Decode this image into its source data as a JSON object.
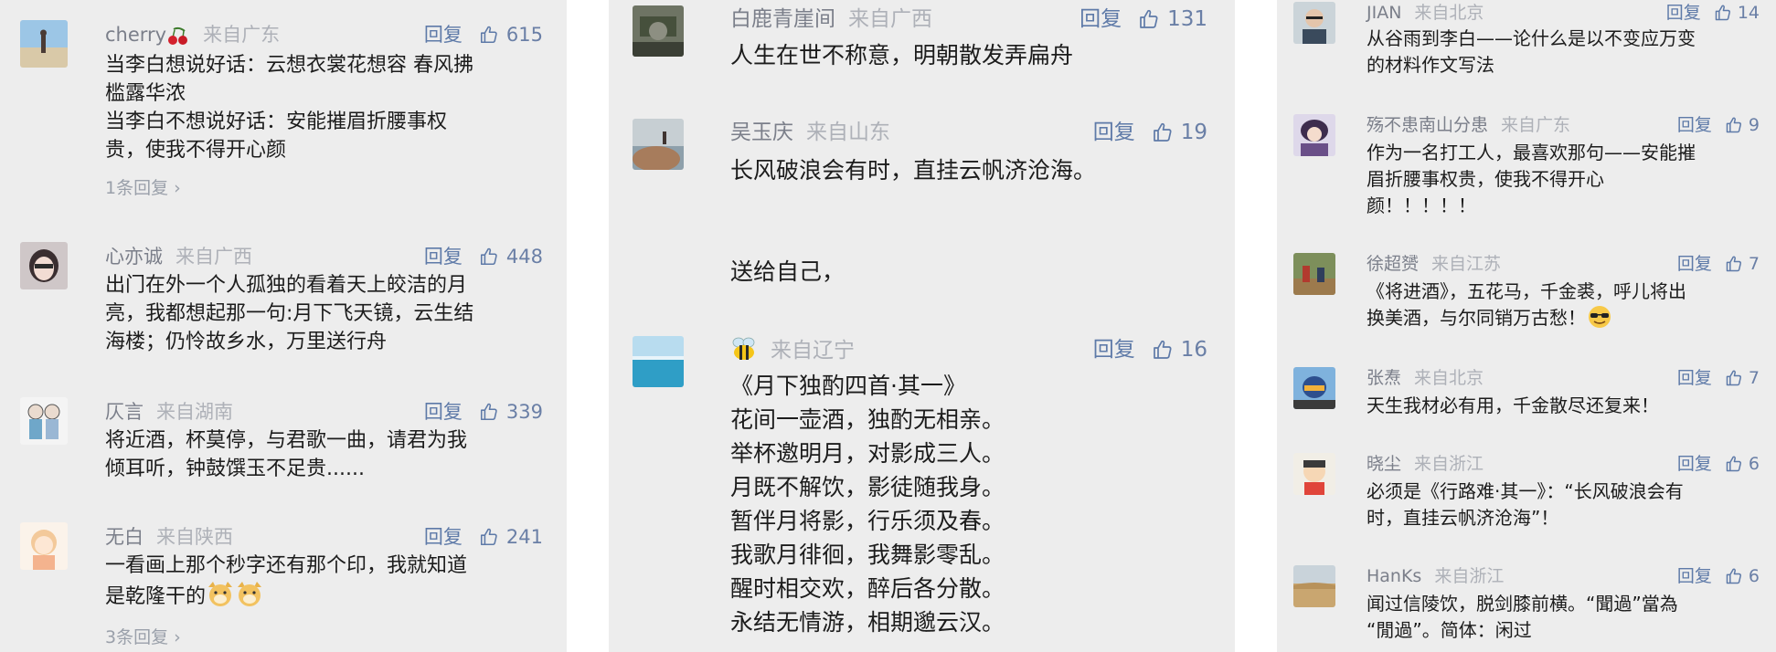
{
  "ui": {
    "reply_label": "回复",
    "like_color": "#5e7aa8",
    "like_icon": "thumbs-up-icon"
  },
  "panel_1": {
    "comments": [
      {
        "username": "cherry",
        "username_emoji": "cherry-emoji",
        "location": "来自广东",
        "likes": "615",
        "lines": [
          "当李白想说好话：云想衣裳花想容 春风拂",
          "槛露华浓",
          "当李白不想说好话：安能摧眉折腰事权",
          "贵，使我不得开心颜"
        ],
        "more_replies": "1条回复",
        "avatar": "beach-person-avatar"
      },
      {
        "username": "心亦诚",
        "location": "来自广西",
        "likes": "448",
        "lines": [
          "出门在外一个人孤独的看着天上皎洁的月",
          "亮，我都想起那一句:月下飞天镜，云生结",
          "海楼；仍怜故乡水，万里送行舟"
        ],
        "avatar": "girl-portrait-avatar"
      },
      {
        "username": "仄言",
        "location": "来自湖南",
        "likes": "339",
        "lines": [
          "将近酒，杯莫停，与君歌一曲，请君为我",
          "倾耳听，钟鼓馔玉不足贵......"
        ],
        "avatar": "cartoon-couple-avatar"
      },
      {
        "username": "无白",
        "location": "来自陕西",
        "likes": "241",
        "lines": [
          "一看画上那个秒字还有那个印，我就知道",
          "是乾隆干的"
        ],
        "line_emoji": "doge-emoji",
        "more_replies": "3条回复",
        "avatar": "cartoon-girl-avatar"
      }
    ]
  },
  "panel_2": {
    "comments": [
      {
        "username": "白鹿青崖间",
        "location": "来自广西",
        "likes": "131",
        "lines": [
          "人生在世不称意，明朝散发弄扁舟"
        ],
        "avatar": "soldier-avatar"
      },
      {
        "username": "吴玉庆",
        "location": "来自山东",
        "likes": "19",
        "lines": [
          "长风破浪会有时，直挂云帆济沧海。",
          "",
          "",
          "送给自己，"
        ],
        "avatar": "rock-sea-avatar"
      },
      {
        "username": "",
        "username_emoji": "bee-emoji",
        "location": "来自辽宁",
        "likes": "16",
        "lines": [
          "《月下独酌四首·其一》",
          "花间一壶酒，独酌无相亲。",
          "举杯邀明月，对影成三人。",
          "月既不解饮，影徒随我身。",
          "暂伴月将影，行乐须及春。",
          "我歌月徘徊，我舞影零乱。",
          "醒时相交欢，醉后各分散。",
          "永结无情游，相期邈云汉。"
        ],
        "avatar": "sea-view-avatar"
      }
    ]
  },
  "panel_3": {
    "comments": [
      {
        "username": "JIAN",
        "location": "来自北京",
        "likes": "14",
        "lines": [
          "从谷雨到李白——论什么是以不变应万变",
          "的材料作文写法"
        ],
        "avatar": "man-glasses-avatar"
      },
      {
        "username": "殇不患南山分患",
        "location": "来自广东",
        "likes": "9",
        "lines": [
          "作为一名打工人，最喜欢那句——安能摧",
          "眉折腰事权贵，使我不得开心",
          "颜！！！！！"
        ],
        "avatar": "anime-character-avatar"
      },
      {
        "username": "徐超赟",
        "location": "来自江苏",
        "likes": "7",
        "lines": [
          "《将进酒》，五花马，千金裘，呼儿将出",
          "换美酒，与尔同销万古愁！"
        ],
        "line_emoji": "cool-sunglasses-emoji",
        "avatar": "outdoor-group-avatar"
      },
      {
        "username": "张焘",
        "location": "来自北京",
        "likes": "7",
        "lines": [
          "天生我材必有用，千金散尽还复来！"
        ],
        "avatar": "helmet-rider-avatar"
      },
      {
        "username": "晓尘",
        "location": "来自浙江",
        "likes": "6",
        "lines": [
          "必须是《行路难·其一》：“长风破浪会有",
          "时，直挂云帆济沧海”！"
        ],
        "avatar": "cartoon-boy-avatar"
      },
      {
        "username": "HanKs",
        "location": "来自浙江",
        "likes": "6",
        "lines": [
          "闻过信陵饮，脱剑膝前横。“聞過”當為",
          "“閒過”。简体：闲过"
        ],
        "avatar": "desert-avatar"
      }
    ]
  }
}
